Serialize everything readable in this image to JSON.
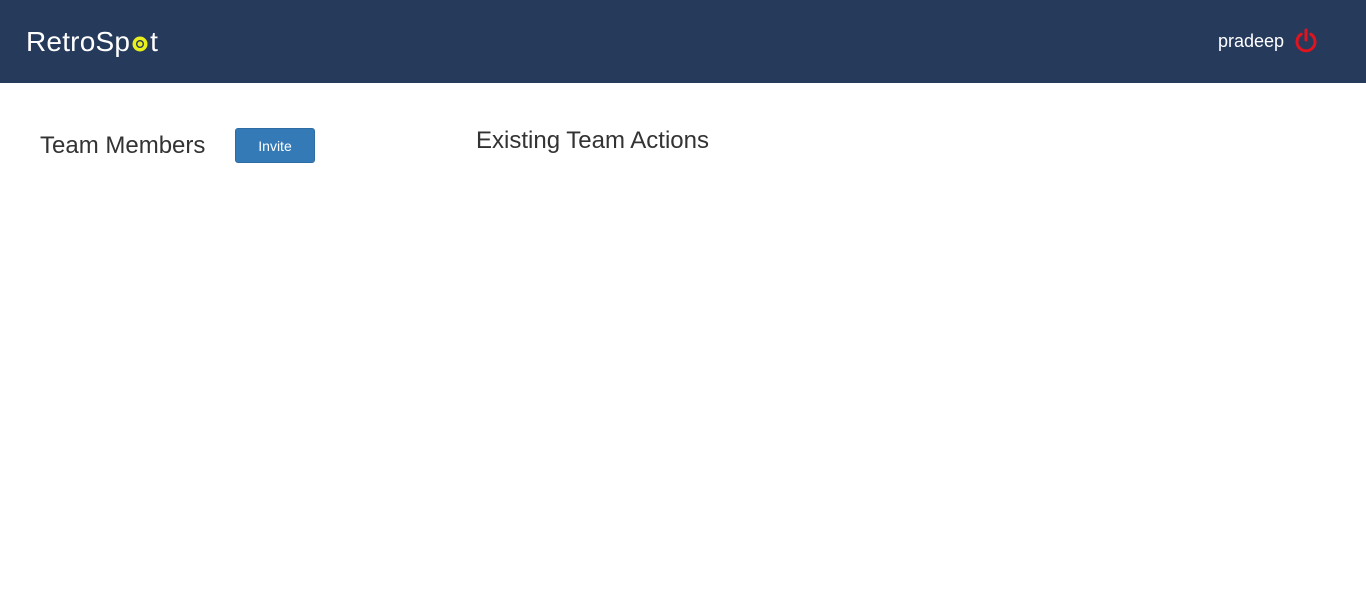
{
  "header": {
    "brand_prefix": "RetroSp",
    "brand_suffix": "t",
    "brand_icon": "yellow-spot-o",
    "username": "pradeep",
    "logout_icon": "power-icon",
    "logout_icon_color": "#e0141e"
  },
  "team_members": {
    "title": "Team Members",
    "invite_label": "Invite"
  },
  "team_actions": {
    "title": "Existing Team Actions"
  },
  "colors": {
    "navbar": "#263a5c",
    "brand_spot": "#e8ef1a",
    "primary_button": "#337ab7"
  }
}
